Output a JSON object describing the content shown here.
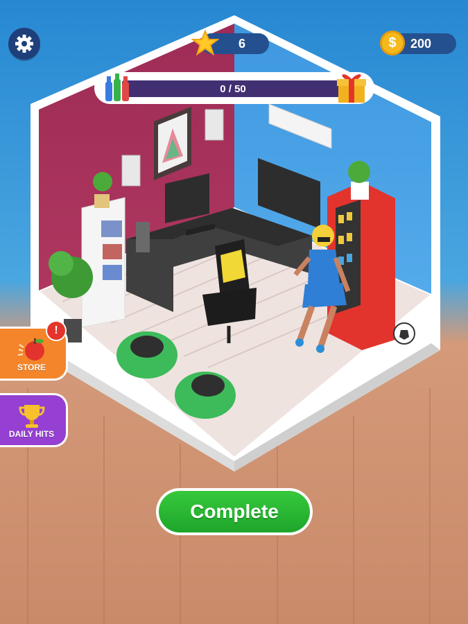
{
  "hud": {
    "stars": "6",
    "coins": "200",
    "coin_symbol": "$"
  },
  "progress": {
    "text": "0 / 50",
    "fraction": 0.0
  },
  "side_buttons": {
    "store_label": "STORE",
    "store_badge": "!",
    "daily_label": "DAILY HITS"
  },
  "complete_label": "Complete",
  "colors": {
    "sky": "#2a93d6",
    "floor": "#c98a6a",
    "complete": "#27b334",
    "store": "#f4852a",
    "daily": "#9540d2",
    "pill": "#25508f"
  }
}
